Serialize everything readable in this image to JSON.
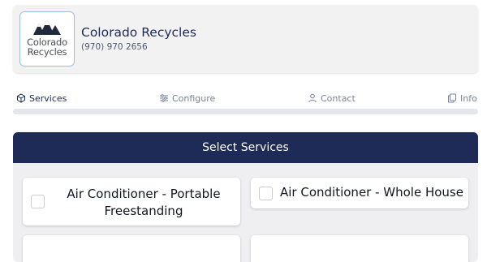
{
  "header": {
    "logo_line1": "Colorado",
    "logo_line2": "Recycles",
    "company_name": "Colorado Recycles",
    "phone": "(970) 970 2656"
  },
  "steps": [
    {
      "label": "Services",
      "icon": "cube-icon",
      "active": true
    },
    {
      "label": "Configure",
      "icon": "sliders-icon",
      "active": false
    },
    {
      "label": "Contact",
      "icon": "person-icon",
      "active": false
    },
    {
      "label": "Info",
      "icon": "copy-icon",
      "active": false
    }
  ],
  "progress": {
    "fraction": 0
  },
  "panel": {
    "title": "Select Services",
    "services": [
      {
        "label": "Air Conditioner - Portable Freestanding",
        "checked": false
      },
      {
        "label": "Air Conditioner - Whole House",
        "checked": false
      }
    ]
  },
  "colors": {
    "navy": "#1f2b57",
    "panel_bg": "#efeff1",
    "logo_border": "#9dc0e3"
  }
}
